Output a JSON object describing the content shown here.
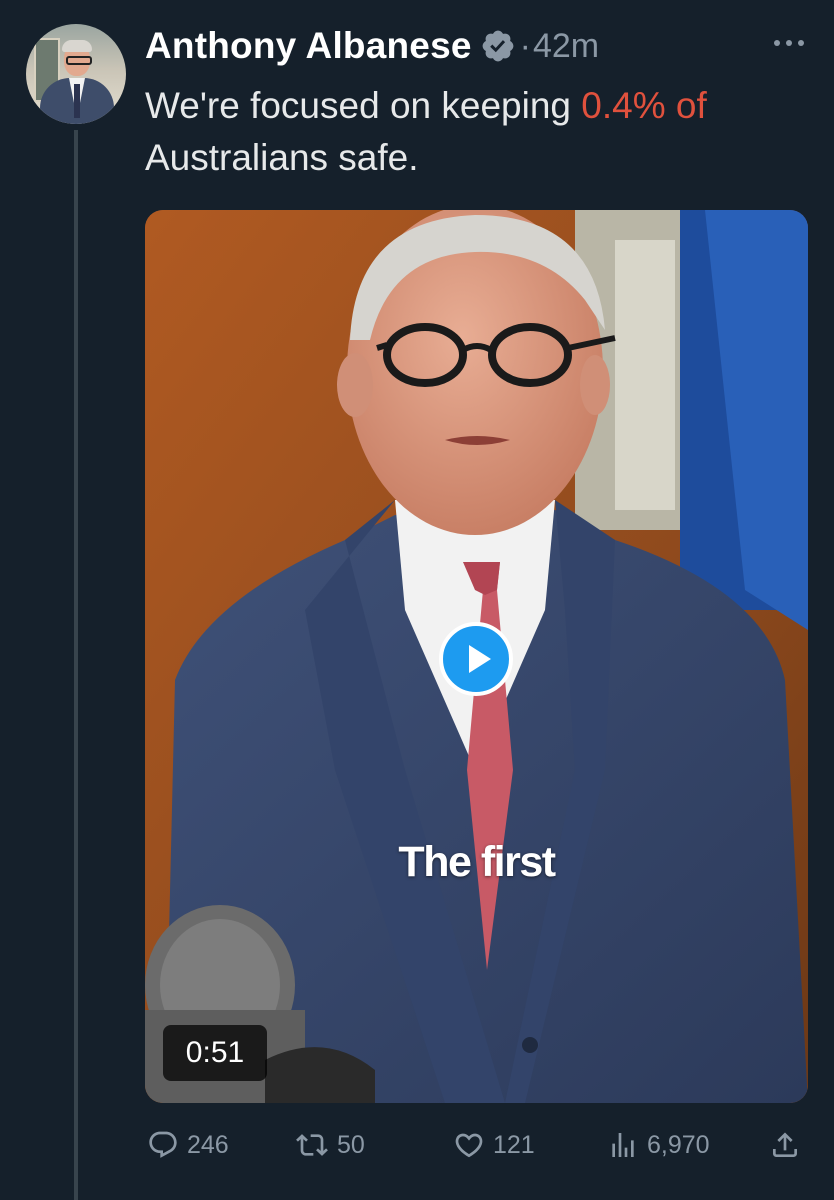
{
  "author": {
    "display_name": "Anthony Albanese",
    "separator": "·",
    "timestamp": "42m"
  },
  "tweet": {
    "text_before": "We're focused on keeping ",
    "text_highlight": "0.4% of",
    "text_after": "Australians safe.",
    "highlight_color": "#e0513d"
  },
  "media": {
    "caption": "The first",
    "duration": "0:51"
  },
  "actions": {
    "replies": "246",
    "reposts": "50",
    "likes": "121",
    "views": "6,970"
  },
  "icons": {
    "verified": "verified-badge-icon",
    "more": "more-options-icon",
    "reply": "reply-icon",
    "repost": "repost-icon",
    "like": "heart-icon",
    "views": "views-chart-icon",
    "share": "share-icon",
    "play": "play-icon"
  },
  "colors": {
    "background": "#15202b",
    "accent": "#1d9bf0",
    "secondary_text": "#8b98a5"
  }
}
